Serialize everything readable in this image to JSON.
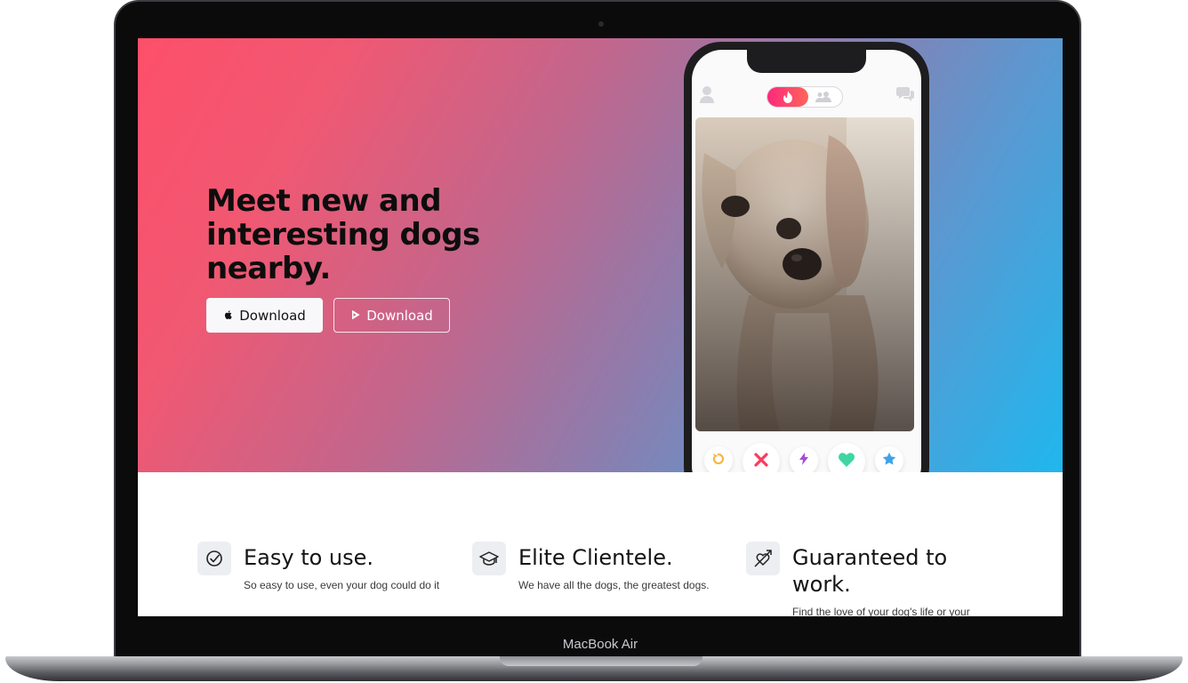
{
  "device": {
    "label": "MacBook Air"
  },
  "hero": {
    "title": "Meet new and interesting dogs nearby.",
    "buttons": [
      {
        "label": "Download",
        "icon": "apple-icon"
      },
      {
        "label": "Download",
        "icon": "play-store-icon"
      }
    ]
  },
  "phone_app": {
    "top_bar": {
      "left_icon": "user-icon",
      "toggle_active_icon": "flame-icon",
      "toggle_inactive_icon": "group-icon",
      "right_icon": "chat-icon"
    },
    "actions": [
      {
        "name": "rewind",
        "icon": "rewind-icon",
        "color": "#f5b748"
      },
      {
        "name": "nope",
        "icon": "close-icon",
        "color": "#fd3a5c"
      },
      {
        "name": "boost",
        "icon": "lightning-icon",
        "color": "#a64bd9"
      },
      {
        "name": "like",
        "icon": "heart-icon",
        "color": "#3fd6a4"
      },
      {
        "name": "super-like",
        "icon": "star-icon",
        "color": "#3fa2e8"
      }
    ]
  },
  "features": [
    {
      "title": "Easy to use.",
      "text": "So easy to use, even your dog could do it",
      "icon": "check-circle-icon"
    },
    {
      "title": "Elite Clientele.",
      "text": "We have all the dogs, the greatest dogs.",
      "icon": "graduation-cap-icon"
    },
    {
      "title": "Guaranteed to work.",
      "text": "Find the love of your dog's life or your",
      "icon": "heart-arrow-icon"
    }
  ],
  "colors": {
    "brand_pink": "#fd4f6a",
    "brand_blue": "#1fb7ee"
  }
}
